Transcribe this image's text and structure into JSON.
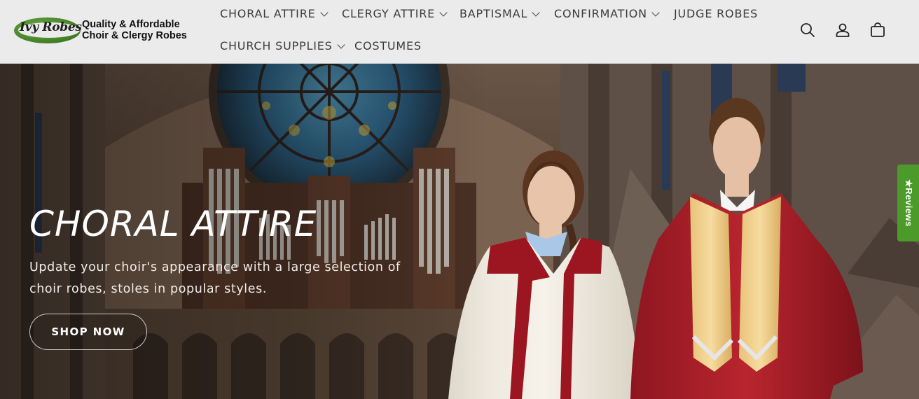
{
  "header": {
    "logo": {
      "script": "Ivy Robes",
      "tagline_line1": "Quality & Affordable",
      "tagline_line2": "Choir & Clergy Robes"
    },
    "nav": [
      {
        "label": "CHORAL ATTIRE",
        "has_dropdown": true
      },
      {
        "label": "CLERGY ATTIRE",
        "has_dropdown": true
      },
      {
        "label": "BAPTISMAL",
        "has_dropdown": true
      },
      {
        "label": "CONFIRMATION",
        "has_dropdown": true
      },
      {
        "label": "JUDGE ROBES",
        "has_dropdown": false
      },
      {
        "label": "CHURCH SUPPLIES",
        "has_dropdown": true
      },
      {
        "label": "COSTUMES",
        "has_dropdown": false
      }
    ],
    "icons": [
      "search-icon",
      "account-icon",
      "cart-icon"
    ]
  },
  "hero": {
    "title": "CHORAL ATTIRE",
    "subtitle": "Update your choir's appearance with a large selection of choir robes, stoles in popular styles.",
    "button_label": "SHOP NOW"
  },
  "reviews_tab": {
    "label": "★Reviews",
    "color": "#4c9a2a"
  },
  "colors": {
    "header_bg": "#ebebeb",
    "nav_text": "#3b3b3b",
    "accent_green": "#4c9a2a"
  }
}
